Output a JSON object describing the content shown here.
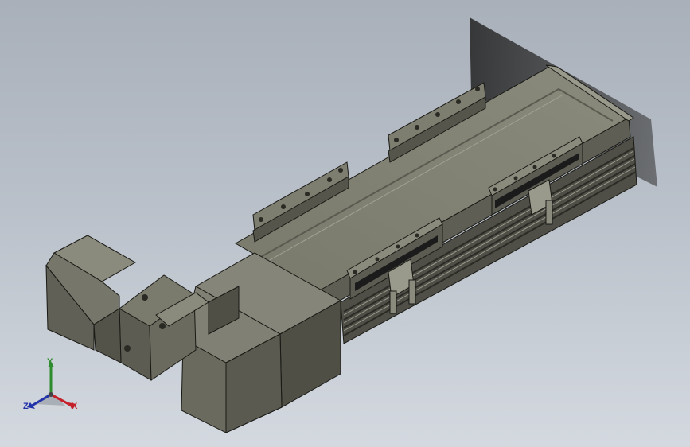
{
  "viewport": {
    "background_top": "#a9b0ba",
    "background_bottom": "#d4d9e0"
  },
  "model": {
    "body_color": "#6f6f62",
    "light_face_color": "#8b8b7d",
    "dark_face_color": "#4e4e45",
    "slot_color": "#1b1b1b",
    "edge_color": "#1a1a16"
  },
  "triad": {
    "x_label": "X",
    "y_label": "Y",
    "z_label": "Z",
    "x_color": "#c4202a",
    "y_color": "#2e8b2e",
    "z_color": "#2233aa"
  }
}
